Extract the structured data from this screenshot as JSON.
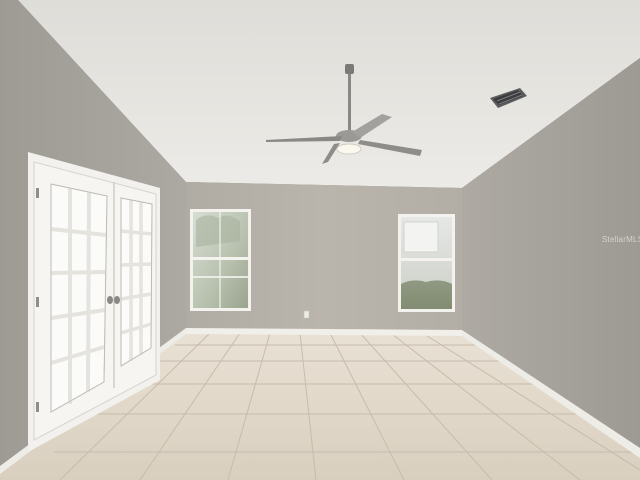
{
  "watermark": {
    "text": "StellarMLS"
  },
  "colors": {
    "ceiling": "#e8e6e1",
    "back_wall": "#b5b0a7",
    "left_wall": "#a7a49e",
    "right_wall": "#a9a59e",
    "floor_light": "#e7dfd2",
    "floor_shadow": "#cfc6b7",
    "grout": "#b8ad9c",
    "trim": "#f4f3ef",
    "window_glass": "#c9d3c6",
    "door_glass": "#f7f8f8"
  },
  "icons": {
    "ceiling_fan": "ceiling-fan-icon",
    "vent": "air-vent-icon",
    "door_handle": "door-handle-icon",
    "outlet": "wall-outlet-icon"
  }
}
